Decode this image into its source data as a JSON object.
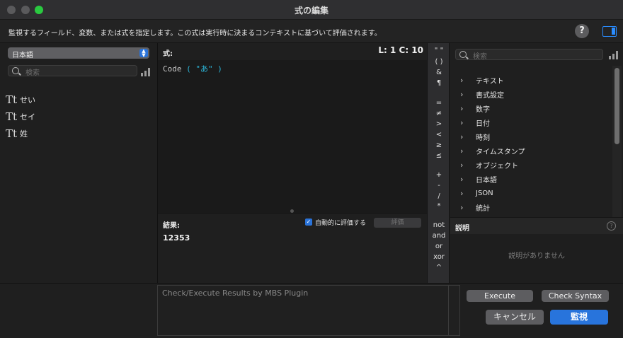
{
  "window": {
    "title": "式の編集"
  },
  "info": {
    "text": "監視するフィールド、変数、または式を指定します。この式は実行時に決まるコンテキストに基づいて評価されます。",
    "help": "?"
  },
  "left": {
    "context": "日本語",
    "search_placeholder": "検索",
    "fields": [
      {
        "icon": "Tt",
        "name": "せい"
      },
      {
        "icon": "Tt",
        "name": "セイ"
      },
      {
        "icon": "Tt",
        "name": "姓"
      }
    ]
  },
  "formula": {
    "label": "式:",
    "cursor": "L: 1 C: 10",
    "code_prefix": "Code",
    "code_arg": "( \"あ\" )"
  },
  "result": {
    "label": "結果:",
    "auto_eval_label": "自動的に評価する",
    "auto_eval_checked": true,
    "eval_button": "評価",
    "value": "12353"
  },
  "operators": [
    "\" \"",
    "( )",
    "&",
    "¶",
    "=",
    "≠",
    ">",
    "<",
    "≥",
    "≤",
    "+",
    "-",
    "/",
    "*",
    "not",
    "and",
    "or",
    "xor",
    "^"
  ],
  "right": {
    "search_placeholder": "検索",
    "categories": [
      "テキスト",
      "書式設定",
      "数字",
      "日付",
      "時刻",
      "タイムスタンプ",
      "オブジェクト",
      "日本語",
      "JSON",
      "統計"
    ],
    "description_label": "説明",
    "description_empty": "説明がありません"
  },
  "bottom": {
    "mbs_placeholder": "Check/Execute Results by MBS Plugin",
    "execute": "Execute",
    "check_syntax": "Check Syntax",
    "cancel": "キャンセル",
    "ok": "監視"
  }
}
